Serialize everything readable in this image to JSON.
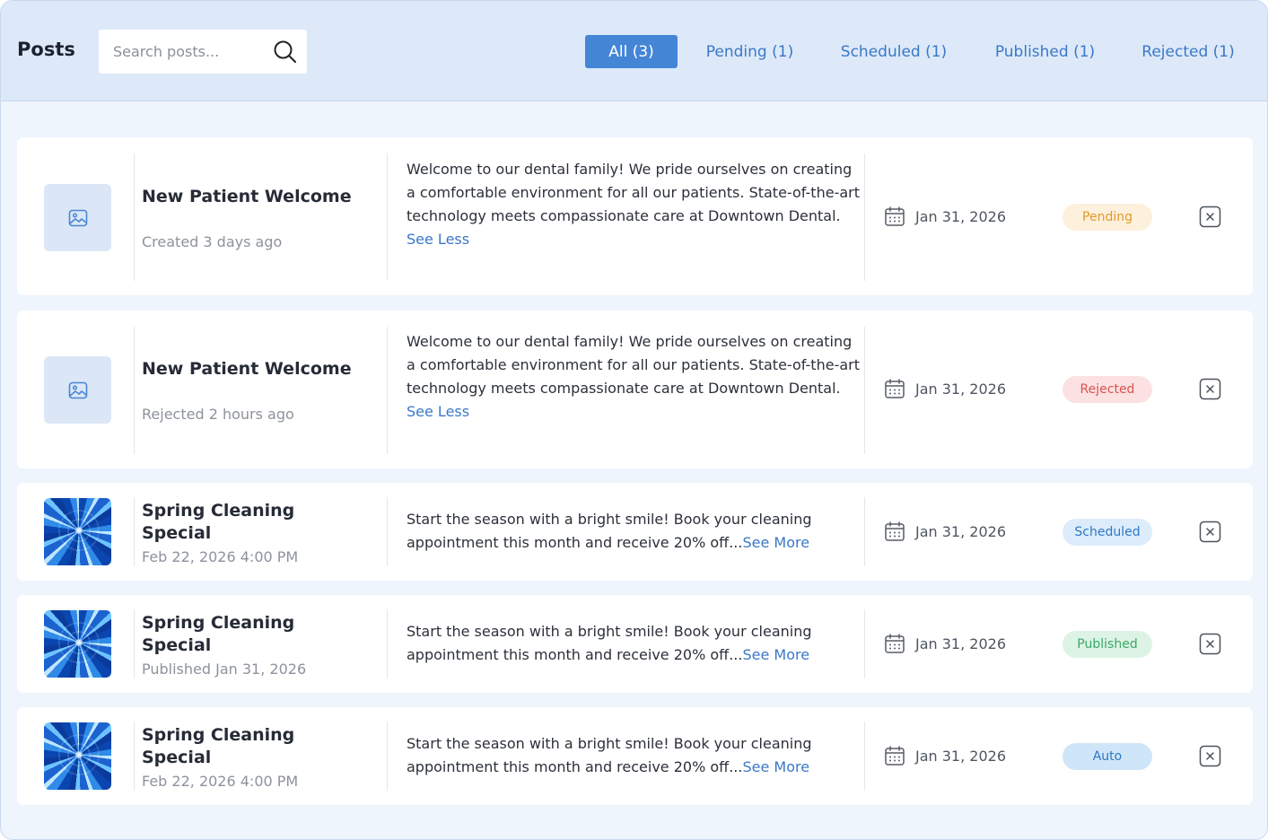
{
  "header": {
    "title": "Posts",
    "search_placeholder": "Search posts...",
    "tabs": [
      {
        "label": "All (3)",
        "active": true
      },
      {
        "label": "Pending (1)",
        "active": false
      },
      {
        "label": "Scheduled (1)",
        "active": false
      },
      {
        "label": "Published (1)",
        "active": false
      },
      {
        "label": "Rejected (1)",
        "active": false
      }
    ]
  },
  "posts": [
    {
      "image": "placeholder-image-icon",
      "title": "New Patient Welcome",
      "meta": "Created 3 days ago",
      "body": "Welcome to our dental family! We pride ourselves on creating a comfortable environment for all our patients. State-of-the-art technology meets compassionate care at Downtown Dental.",
      "link": "See Less",
      "date": "Jan 31, 2026",
      "status": "Pending"
    },
    {
      "image": "placeholder-image-icon",
      "title": "New Patient Welcome",
      "meta": "Rejected 2 hours ago",
      "body": "Welcome to our dental family! We pride ourselves on creating a comfortable environment for all our patients. State-of-the-art technology meets compassionate care at Downtown Dental.",
      "link": "See Less",
      "date": "Jan 31, 2026",
      "status": "Rejected"
    },
    {
      "image": "blue-swirl-image",
      "title": "Spring Cleaning Special",
      "meta": "Feb 22, 2026 4:00 PM",
      "body": "Start the season with a bright smile! Book your cleaning appointment this month and receive 20% off...",
      "link": "See More",
      "date": "Jan 31, 2026",
      "status": "Scheduled"
    },
    {
      "image": "blue-swirl-image",
      "title": "Spring Cleaning Special",
      "meta": "Published Jan 31, 2026",
      "body": "Start the season with a bright smile! Book your cleaning appointment this month and receive 20% off...",
      "link": "See More",
      "date": "Jan 31, 2026",
      "status": "Published"
    },
    {
      "image": "blue-swirl-image",
      "title": "Spring Cleaning Special",
      "meta": "Feb 22, 2026 4:00 PM",
      "body": "Start the season with a bright smile! Book your cleaning appointment this month and receive 20% off...",
      "link": "See More",
      "date": "Jan 31, 2026",
      "status": "Auto"
    }
  ],
  "status_colors": {
    "Pending": {
      "bg": "#fdf0dc",
      "fg": "#e29a2c"
    },
    "Rejected": {
      "bg": "#fbe1e2",
      "fg": "#d9534f"
    },
    "Scheduled": {
      "bg": "#dcecfb",
      "fg": "#2f78c4"
    },
    "Published": {
      "bg": "#ddf3e5",
      "fg": "#3aa867"
    },
    "Auto": {
      "bg": "#cfe5f8",
      "fg": "#2f78c4"
    }
  },
  "colors": {
    "accent": "#4585d6",
    "link": "#3a78c7",
    "header_bg": "#dde9f9",
    "page_bg": "#eef5fd"
  }
}
